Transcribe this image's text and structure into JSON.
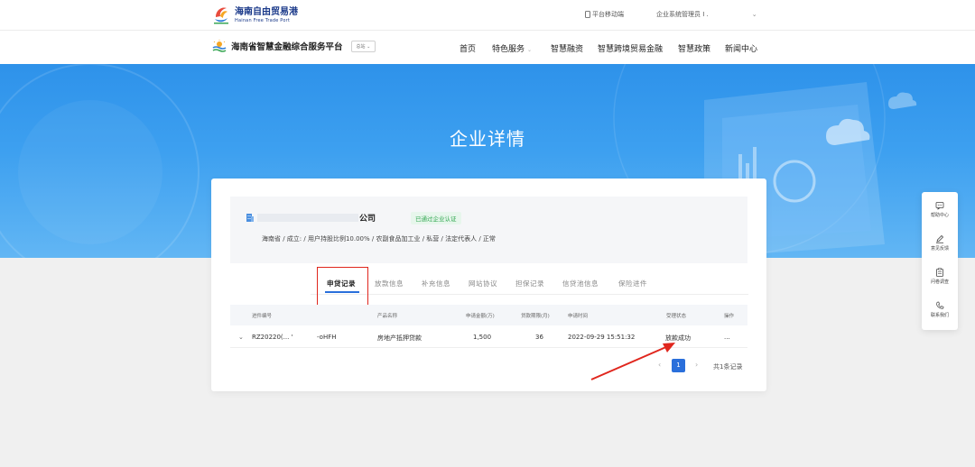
{
  "topbar": {
    "logo_cn": "海南自由贸易港",
    "logo_en": "Hainan Free Trade Port",
    "mobile_label": "平台移动端",
    "admin_label": "企业系统管理员 I ."
  },
  "navbar": {
    "brand_title": "海南省智慧金融综合服务平台",
    "station_label": "总站",
    "menu": [
      {
        "label": "首页"
      },
      {
        "label": "特色服务"
      },
      {
        "label": "智慧融资"
      },
      {
        "label": "智慧跨境贸易金融"
      },
      {
        "label": "智慧政策"
      },
      {
        "label": "新闻中心"
      }
    ]
  },
  "hero": {
    "title": "企业详情"
  },
  "company": {
    "name": "公司",
    "cert_badge": "已通过企业认证",
    "info": "海南省 / 成立:      / 用户持股比例10.00% / 农副食品加工业 / 私营 / 法定代表人         / 正常"
  },
  "tabs": [
    {
      "label": "申贷记录"
    },
    {
      "label": "放款信息"
    },
    {
      "label": "补充信息"
    },
    {
      "label": "网站协议"
    },
    {
      "label": "担保记录"
    },
    {
      "label": "信贷池信息"
    },
    {
      "label": "保险进件"
    }
  ],
  "table": {
    "headers": [
      "进件编号",
      "产品名称",
      "申请金额(万)",
      "贷款期限(月)",
      "申请时间",
      "受理状态",
      "操作"
    ],
    "rows": [
      {
        "id": "RZ20220(...  ' ",
        "id_suffix": "-oHFH",
        "product": "房地产抵押贷款",
        "amount": "1,500",
        "term": "36",
        "time": "2022-09-29 15:51:32",
        "status": "放款成功",
        "action": "..."
      }
    ]
  },
  "pagination": {
    "current": "1",
    "total_label": "共1条记录"
  },
  "side_widget": [
    {
      "label": "帮助中心",
      "icon": "help-center-icon"
    },
    {
      "label": "意见反馈",
      "icon": "edit-icon"
    },
    {
      "label": "问卷调查",
      "icon": "clipboard-icon"
    },
    {
      "label": "联系我们",
      "icon": "phone-icon"
    }
  ],
  "colors": {
    "primary": "#2a6fdb",
    "hero_blue": "#3da0f0",
    "success_green": "#34a853",
    "annotation_red": "#e0261d"
  }
}
